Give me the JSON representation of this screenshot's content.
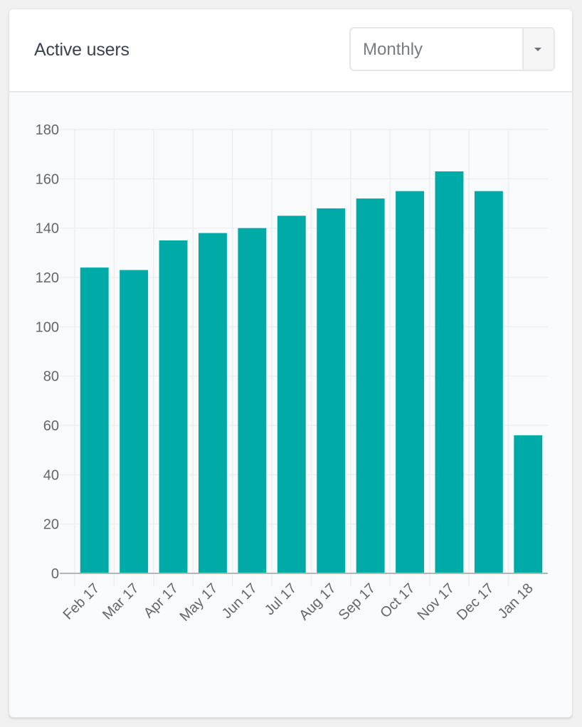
{
  "card": {
    "title": "Active users",
    "period_select": {
      "value": "Monthly"
    }
  },
  "colors": {
    "bar": "#00aaa7",
    "grid": "#eceef0",
    "axis": "#b5b5b5",
    "tick_text": "#666666"
  },
  "chart_data": {
    "type": "bar",
    "title": "Active users",
    "xlabel": "",
    "ylabel": "",
    "categories": [
      "Feb 17",
      "Mar 17",
      "Apr 17",
      "May 17",
      "Jun 17",
      "Jul 17",
      "Aug 17",
      "Sep 17",
      "Oct 17",
      "Nov 17",
      "Dec 17",
      "Jan 18"
    ],
    "values": [
      124,
      123,
      135,
      138,
      140,
      145,
      148,
      152,
      155,
      163,
      155,
      56
    ],
    "ylim": [
      0,
      180
    ],
    "yticks": [
      0,
      20,
      40,
      60,
      80,
      100,
      120,
      140,
      160,
      180
    ],
    "grid": true,
    "legend": "none",
    "x_tick_rotation_deg": -45
  }
}
